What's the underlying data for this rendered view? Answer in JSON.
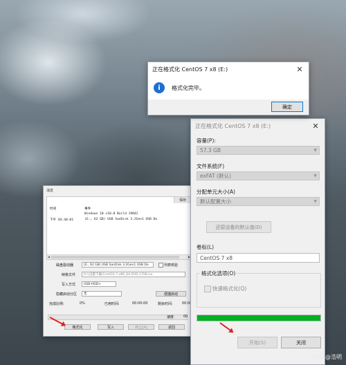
{
  "dialog": {
    "title": "正在格式化 CentOS 7 x8 (E:)",
    "message": "格式化完毕。",
    "ok_label": "确定"
  },
  "format_panel": {
    "title": "正在格式化 CentOS 7 x8 (E:)",
    "capacity_label": "容量(P):",
    "capacity_value": "57.3 GB",
    "filesystem_label": "文件系统(F)",
    "filesystem_value": "exFAT (默认)",
    "allocation_label": "分配单元大小(A)",
    "allocation_value": "默认配置大小",
    "restore_label": "还原设备的默认值(D)",
    "volume_label_label": "卷标(L)",
    "volume_label_value": "CentOS 7 x8",
    "options_label": "格式化选项(O)",
    "quick_format_label": "快速格式化(Q)",
    "progress": 1.0,
    "progress_color": "#06b025",
    "start_label": "开始(S)",
    "close_label": "关闭"
  },
  "rufus": {
    "log_header": "消息",
    "log_tab": "保存",
    "col_time": "时间",
    "col_event": "事件",
    "event1": "Windows 10 v10.0 Build 19042",
    "row_time": "下午 03:40:01",
    "event2": "(E:, 62 GB) USB  SanDisk 3.2Gen1 USB De",
    "device_label": "磁盘驱动器",
    "device_value": "(E:, 62 GB) USB  SanDisk 3.2Gen1 USB De",
    "list_usb_label": "列表校验",
    "image_label": "映像文件",
    "image_value": "D:\\\\迅雷下载\\CentOS-7-x86_64-DVD-1708.iso",
    "write_mode_label": "写入方式",
    "write_mode_value": "USB-HDD+",
    "hide_boot_label": "隐藏启动分区",
    "hide_boot_value": "无",
    "convenience_button": "便捷启动",
    "completion_label": "完成比例:",
    "completion_value": "0%",
    "elapsed_label": "已用时间:",
    "elapsed_value": "00:00:00",
    "remaining_label": "剩余时间:",
    "remaining_value": "00:00:00",
    "speed_label": "速度",
    "speed_value": "00",
    "format_button": "格式化",
    "write_button": "写入",
    "terminate_button": "终止[A]",
    "back_button": "返回"
  },
  "watermark": "CSDN @浩明"
}
